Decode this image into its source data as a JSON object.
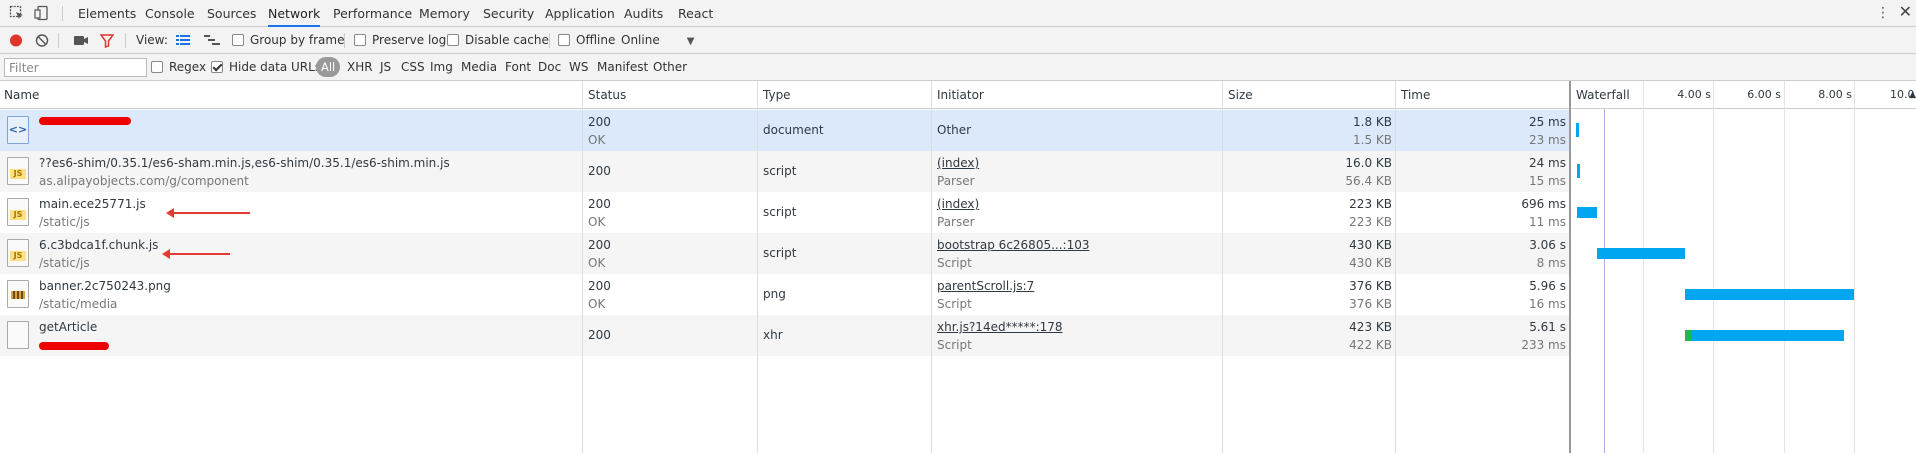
{
  "tabs": [
    {
      "label": "Elements"
    },
    {
      "label": "Console"
    },
    {
      "label": "Sources"
    },
    {
      "label": "Network",
      "active": true
    },
    {
      "label": "Performance"
    },
    {
      "label": "Memory"
    },
    {
      "label": "Security"
    },
    {
      "label": "Application"
    },
    {
      "label": "Audits"
    },
    {
      "label": "React"
    }
  ],
  "toolbar": {
    "view_label": "View:",
    "group_by_frame": "Group by frame",
    "preserve_log": "Preserve log",
    "disable_cache": "Disable cache",
    "offline": "Offline",
    "throttle": "Online"
  },
  "filterbar": {
    "filter_placeholder": "Filter",
    "regex": "Regex",
    "hide_data_urls": "Hide data URLs",
    "types": [
      "All",
      "XHR",
      "JS",
      "CSS",
      "Img",
      "Media",
      "Font",
      "Doc",
      "WS",
      "Manifest",
      "Other"
    ]
  },
  "columns": {
    "name": "Name",
    "status": "Status",
    "type": "Type",
    "initiator": "Initiator",
    "size": "Size",
    "time": "Time",
    "waterfall": "Waterfall"
  },
  "waterfall_ticks": [
    "4.00 s",
    "6.00 s",
    "8.00 s",
    "10.0"
  ],
  "requests": [
    {
      "icon": "html-document-icon",
      "name": "",
      "path": "",
      "status": "200",
      "status_text": "OK",
      "type": "document",
      "initiator": "Other",
      "initiator_detail": "",
      "size": "1.8 KB",
      "size_resource": "1.5 KB",
      "time": "25 ms",
      "latency": "23 ms",
      "bar_start_s": 0.0,
      "bar_end_s": 0.05,
      "redacted_name": true
    },
    {
      "icon": "js-file-icon",
      "name": "??es6-shim/0.35.1/es6-sham.min.js,es6-shim/0.35.1/es6-shim.min.js",
      "path": "as.alipayobjects.com/g/component",
      "status": "200",
      "status_text": "",
      "type": "script",
      "initiator": "(index)",
      "initiator_detail": "Parser",
      "size": "16.0 KB",
      "size_resource": "56.4 KB",
      "time": "24 ms",
      "latency": "15 ms",
      "bar_start_s": 0.05,
      "bar_end_s": 0.1
    },
    {
      "icon": "js-file-icon",
      "name": "main.ece25771.js",
      "path": "/static/js",
      "status": "200",
      "status_text": "OK",
      "type": "script",
      "initiator": "(index)",
      "initiator_detail": "Parser",
      "size": "223 KB",
      "size_resource": "223 KB",
      "time": "696 ms",
      "latency": "11 ms",
      "bar_start_s": 0.05,
      "bar_end_s": 0.75,
      "annotated": true
    },
    {
      "icon": "js-file-icon",
      "name": "6.c3bdca1f.chunk.js",
      "path": "/static/js",
      "status": "200",
      "status_text": "OK",
      "type": "script",
      "initiator": "bootstrap 6c26805...:103",
      "initiator_detail": "Script",
      "size": "430 KB",
      "size_resource": "430 KB",
      "time": "3.06 s",
      "latency": "8 ms",
      "bar_start_s": 0.75,
      "bar_end_s": 3.81,
      "annotated": true
    },
    {
      "icon": "png-image-icon",
      "name": "banner.2c750243.png",
      "path": "/static/media",
      "status": "200",
      "status_text": "OK",
      "type": "png",
      "initiator": "parentScroll.js:7",
      "initiator_detail": "Script",
      "size": "376 KB",
      "size_resource": "376 KB",
      "time": "5.96 s",
      "latency": "16 ms",
      "bar_start_s": 3.81,
      "bar_end_s": 9.77
    },
    {
      "icon": "blank-file-icon",
      "name": "getArticle",
      "path": "",
      "status": "200",
      "status_text": "",
      "type": "xhr",
      "initiator": "xhr.js?14ed*****:178",
      "initiator_detail": "Script",
      "size": "423 KB",
      "size_resource": "422 KB",
      "time": "5.61 s",
      "latency": "233 ms",
      "bar_start_s": 3.81,
      "bar_end_s": 9.42,
      "bar_wait_s": 0.23,
      "redacted_path": true
    }
  ]
}
